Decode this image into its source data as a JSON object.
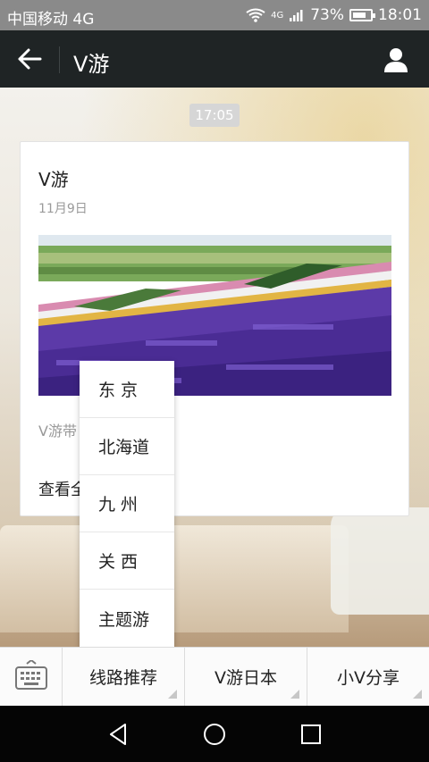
{
  "status": {
    "carrier": "中国移动 4G",
    "signal_tag": "4G",
    "battery": "73%",
    "time": "18:01"
  },
  "header": {
    "title": "V游"
  },
  "chat": {
    "timestamp": "17:05",
    "card": {
      "title": "V游",
      "date": "11月9日",
      "desc": "V游带",
      "more": "查看全"
    }
  },
  "popup_menu": [
    "东 京",
    "北海道",
    "九 州",
    "关 西",
    "主题游"
  ],
  "bottom_menu": [
    "线路推荐",
    "V游日本",
    "小V分享"
  ],
  "icons": [
    "back-arrow-icon",
    "user-icon",
    "keyboard-icon",
    "nav-back-icon",
    "nav-home-icon",
    "nav-recent-icon"
  ],
  "colors": {
    "header_bg": "#1f2425",
    "status_bg": "#8a8a8a",
    "nav_bg": "#050505"
  }
}
